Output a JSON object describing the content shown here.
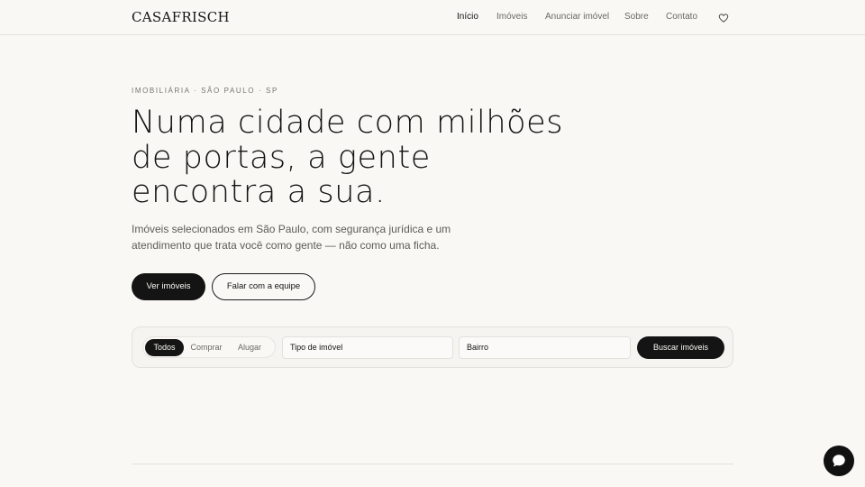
{
  "header": {
    "logo": "CASAFRISCH",
    "nav": [
      {
        "label": "Início",
        "active": true
      },
      {
        "label": "Imóveis",
        "active": false
      },
      {
        "label": "Anunciar imóvel",
        "active": false
      },
      {
        "label": "Sobre",
        "active": false
      },
      {
        "label": "Contato",
        "active": false
      }
    ],
    "favorites_icon": "heart-icon"
  },
  "hero": {
    "eyebrow": "IMOBILIÁRIA · SÃO PAULO · SP",
    "headline_lines": [
      "Numa cidade com milhões",
      "de portas, a gente",
      "encontra a sua."
    ],
    "lede_lines": [
      "Imóveis selecionados em São Paulo, com segurança jurídica e um",
      "atendimento que trata você como gente — não como uma ficha."
    ],
    "primary_cta": "Ver imóveis",
    "secondary_cta": "Falar com a equipe"
  },
  "search": {
    "modes": [
      {
        "label": "Todos",
        "selected": true
      },
      {
        "label": "Comprar",
        "selected": false
      },
      {
        "label": "Alugar",
        "selected": false
      }
    ],
    "type_field": "Tipo de imóvel",
    "district_field": "Bairro",
    "submit": "Buscar imóveis"
  },
  "chat": {
    "icon": "chat-bubble-icon"
  },
  "colors": {
    "background": "#f9f8f5",
    "ink": "#141414",
    "muted": "#6a6964",
    "border": "#e3e1dc"
  }
}
